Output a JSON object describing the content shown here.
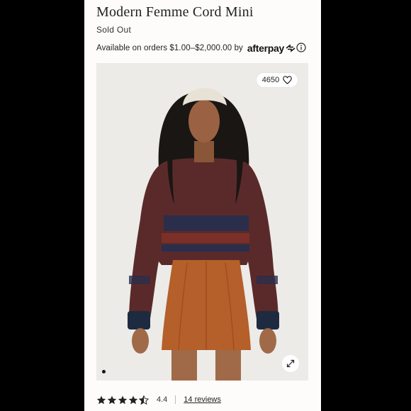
{
  "product": {
    "title": "Modern Femme Cord Mini",
    "status": "Sold Out"
  },
  "afterpay": {
    "text": "Available on orders $1.00–$2,000.00 by",
    "brand": "afterpay"
  },
  "gallery": {
    "like_count": "4650"
  },
  "rating": {
    "value": "4.4",
    "stars": 4.4,
    "reviews_label": "14 reviews"
  },
  "colors": {
    "background": "#000000",
    "page": "#fdfcfa",
    "text": "#222222"
  }
}
